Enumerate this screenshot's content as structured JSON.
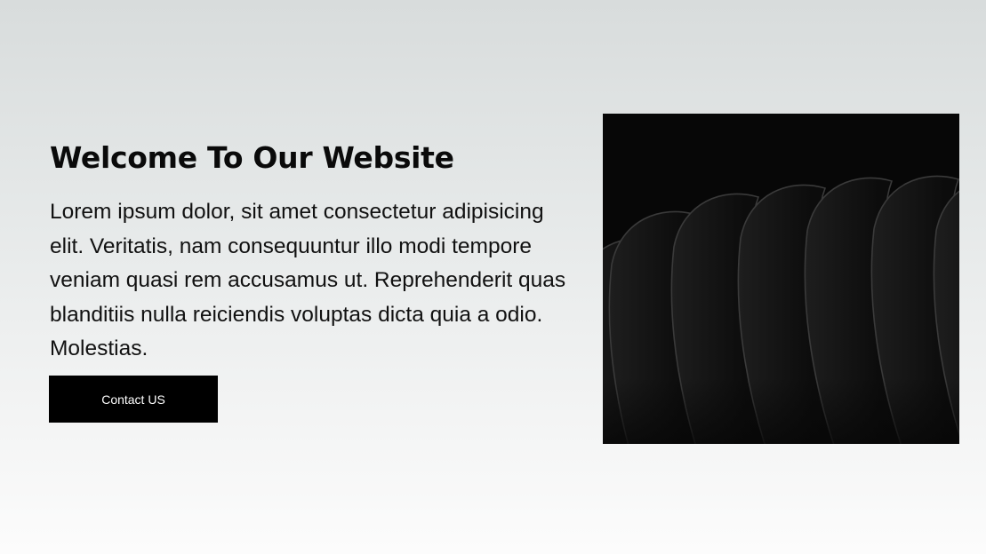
{
  "hero": {
    "title": "Welcome To Our Website",
    "body": "Lorem ipsum dolor, sit amet consectetur adipisicing elit. Veritatis, nam consequuntur illo modi tempore veniam quasi rem accusamus ut. Reprehenderit quas blanditiis nulla reiciendis voluptas dicta quia a odio. Molestias.",
    "button_label": "Contact US",
    "image_description": "abstract-black-wave-render"
  },
  "colors": {
    "button_bg": "#000000",
    "button_text": "#ffffff",
    "title": "#0a0a0a",
    "image_bg": "#070707"
  }
}
